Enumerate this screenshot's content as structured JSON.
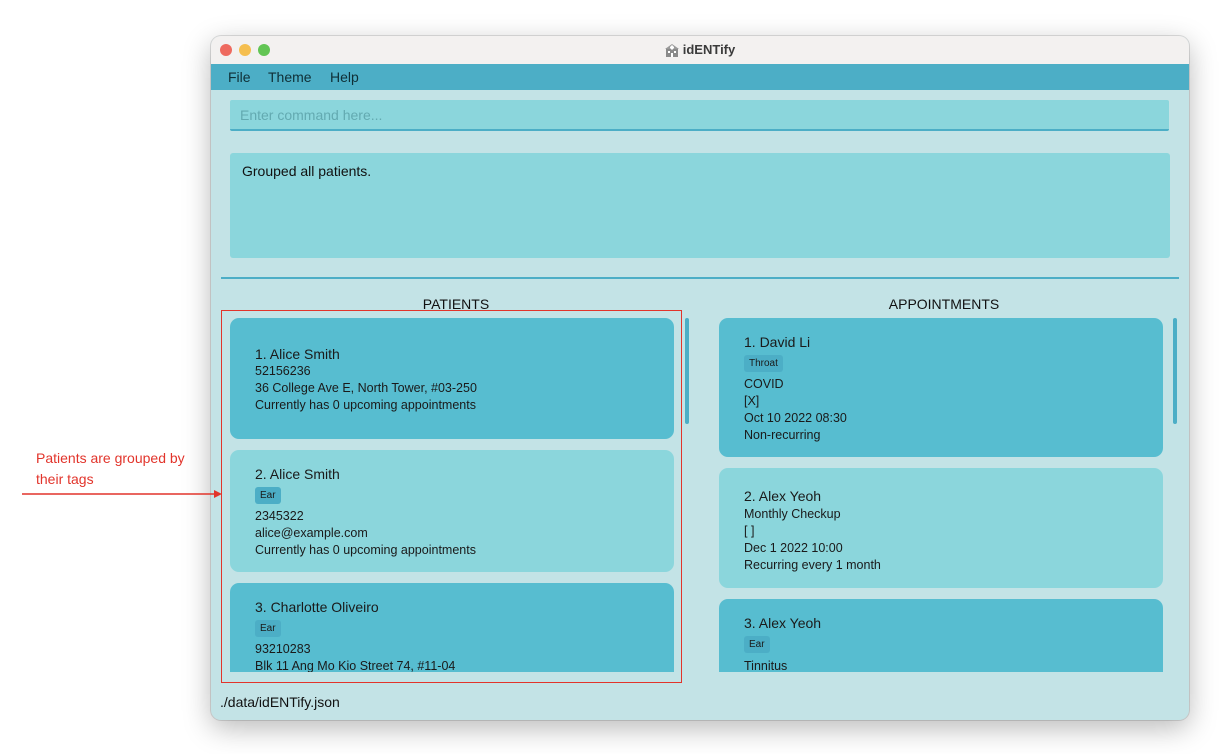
{
  "window": {
    "title": "idENTify"
  },
  "menu": {
    "file": "File",
    "theme": "Theme",
    "help": "Help"
  },
  "command": {
    "placeholder": "Enter command here...",
    "value": ""
  },
  "result": {
    "text": "Grouped all patients."
  },
  "patients": {
    "header": "PATIENTS",
    "items": [
      {
        "name": "1.  Alice Smith",
        "phone": "52156236",
        "address": "36 College Ave E, North Tower, #03-250",
        "appointments": "Currently has 0 upcoming appointments"
      },
      {
        "name": "2.  Alice Smith",
        "tag": "Ear",
        "phone": "2345322",
        "email": "alice@example.com",
        "appointments": "Currently has 0 upcoming appointments"
      },
      {
        "name": "3.  Charlotte Oliveiro",
        "tag": "Ear",
        "phone": "93210283",
        "address": "Blk 11 Ang Mo Kio Street 74, #11-04"
      }
    ]
  },
  "appointments": {
    "header": "APPOINTMENTS",
    "items": [
      {
        "name": "1.  David Li",
        "tag": "Throat",
        "reason": "COVID",
        "status": "[X]",
        "datetime": "Oct 10 2022 08:30",
        "recurrence": "Non-recurring"
      },
      {
        "name": "2.  Alex Yeoh",
        "reason": "Monthly Checkup",
        "status": "[ ]",
        "datetime": "Dec 1 2022 10:00",
        "recurrence": "Recurring every 1 month"
      },
      {
        "name": "3.  Alex Yeoh",
        "tag": "Ear",
        "reason": "Tinnitus"
      }
    ]
  },
  "status_bar": {
    "path": "./data/idENTify.json"
  },
  "annotation": {
    "line1": "Patients are grouped by",
    "line2": "their tags"
  },
  "colors": {
    "menubar": "#4caec6",
    "card_dark": "#57bdd0",
    "card_light": "#8bd6dc",
    "background": "#c3e3e6",
    "annotation": "#e2342b"
  }
}
